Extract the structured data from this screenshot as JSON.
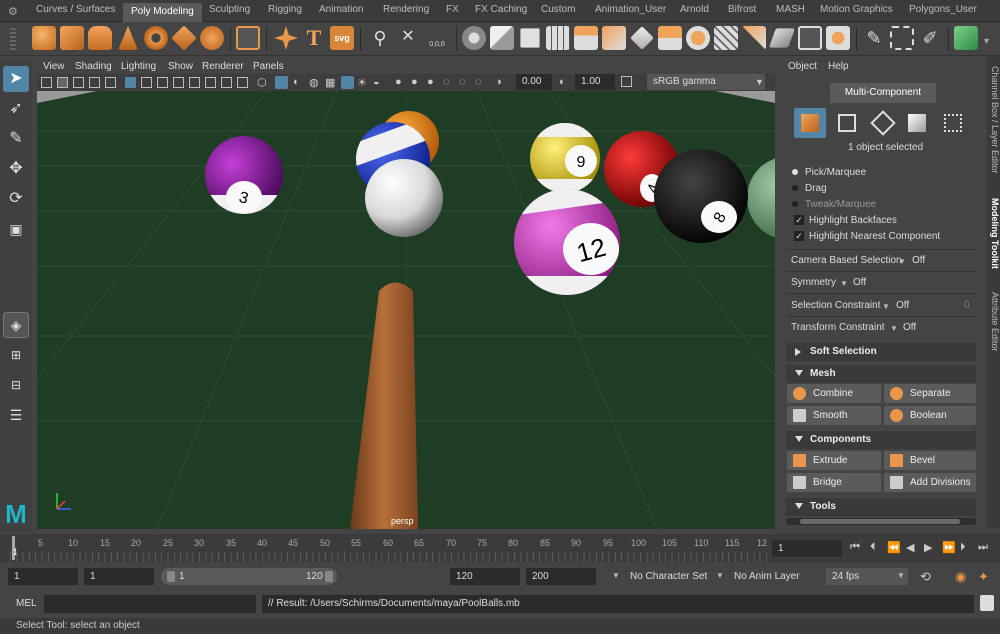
{
  "shelf": {
    "tabs": [
      "Curves / Surfaces",
      "Poly Modeling",
      "Sculpting",
      "Rigging",
      "Animation",
      "Rendering",
      "FX",
      "FX Caching",
      "Custom",
      "Animation_User",
      "Arnold",
      "Bifrost",
      "MASH",
      "Motion Graphics",
      "Polygons_User"
    ],
    "active_tab": "Poly Modeling",
    "icon_text": {
      "svg": "svg",
      "text_tool": "T",
      "coords": "0,0,0"
    }
  },
  "viewport": {
    "menu": [
      "View",
      "Shading",
      "Lighting",
      "Show",
      "Renderer",
      "Panels"
    ],
    "exposure": "0.00",
    "gamma": "1.00",
    "color_space": "sRGB gamma",
    "camera_label": "persp",
    "balls": [
      "3",
      "9",
      "4",
      "8",
      "12"
    ]
  },
  "right_panel": {
    "menu": [
      "Object",
      "Help"
    ],
    "mode": "Multi-Component",
    "selection_status": "1 object selected",
    "pick_options": [
      "Pick/Marquee",
      "Drag",
      "Tweak/Marquee"
    ],
    "checks": [
      "Highlight Backfaces",
      "Highlight Nearest Component"
    ],
    "camera_based_selection": {
      "label": "Camera Based Selection",
      "value": "Off"
    },
    "symmetry": {
      "label": "Symmetry",
      "value": "Off"
    },
    "selection_constraint": {
      "label": "Selection Constraint",
      "value": "Off",
      "num": "0"
    },
    "transform_constraint": {
      "label": "Transform Constraint",
      "value": "Off"
    },
    "sections": {
      "soft": "Soft Selection",
      "mesh": "Mesh",
      "components": "Components",
      "tools": "Tools"
    },
    "mesh_buttons": [
      "Combine",
      "Separate",
      "Smooth",
      "Boolean"
    ],
    "component_buttons": [
      "Extrude",
      "Bevel",
      "Bridge",
      "Add Divisions"
    ],
    "side_tabs": [
      "Channel Box / Layer Editor",
      "Modeling Toolkit",
      "Attribute Editor"
    ]
  },
  "timeline": {
    "ticks": [
      "5",
      "10",
      "15",
      "20",
      "25",
      "30",
      "35",
      "40",
      "45",
      "50",
      "55",
      "60",
      "65",
      "70",
      "75",
      "80",
      "85",
      "90",
      "95",
      "100",
      "105",
      "110",
      "115",
      "12"
    ],
    "current_frame_marker": "1",
    "current_frame": "1"
  },
  "range": {
    "start": "1",
    "anim_start": "1",
    "slider_start": "1",
    "slider_end": "120",
    "anim_end": "120",
    "end": "200",
    "character_set": "No Character Set",
    "anim_layer": "No Anim Layer",
    "fps": "24 fps"
  },
  "command": {
    "label": "MEL",
    "result": "// Result: /Users/Schirms/Documents/maya/PoolBalls.mb"
  },
  "help_line": "Select Tool: select an object",
  "colors": {
    "accent": "#5285a6",
    "viewport_bg": "#1f3d25",
    "panel_bg": "#444444"
  }
}
